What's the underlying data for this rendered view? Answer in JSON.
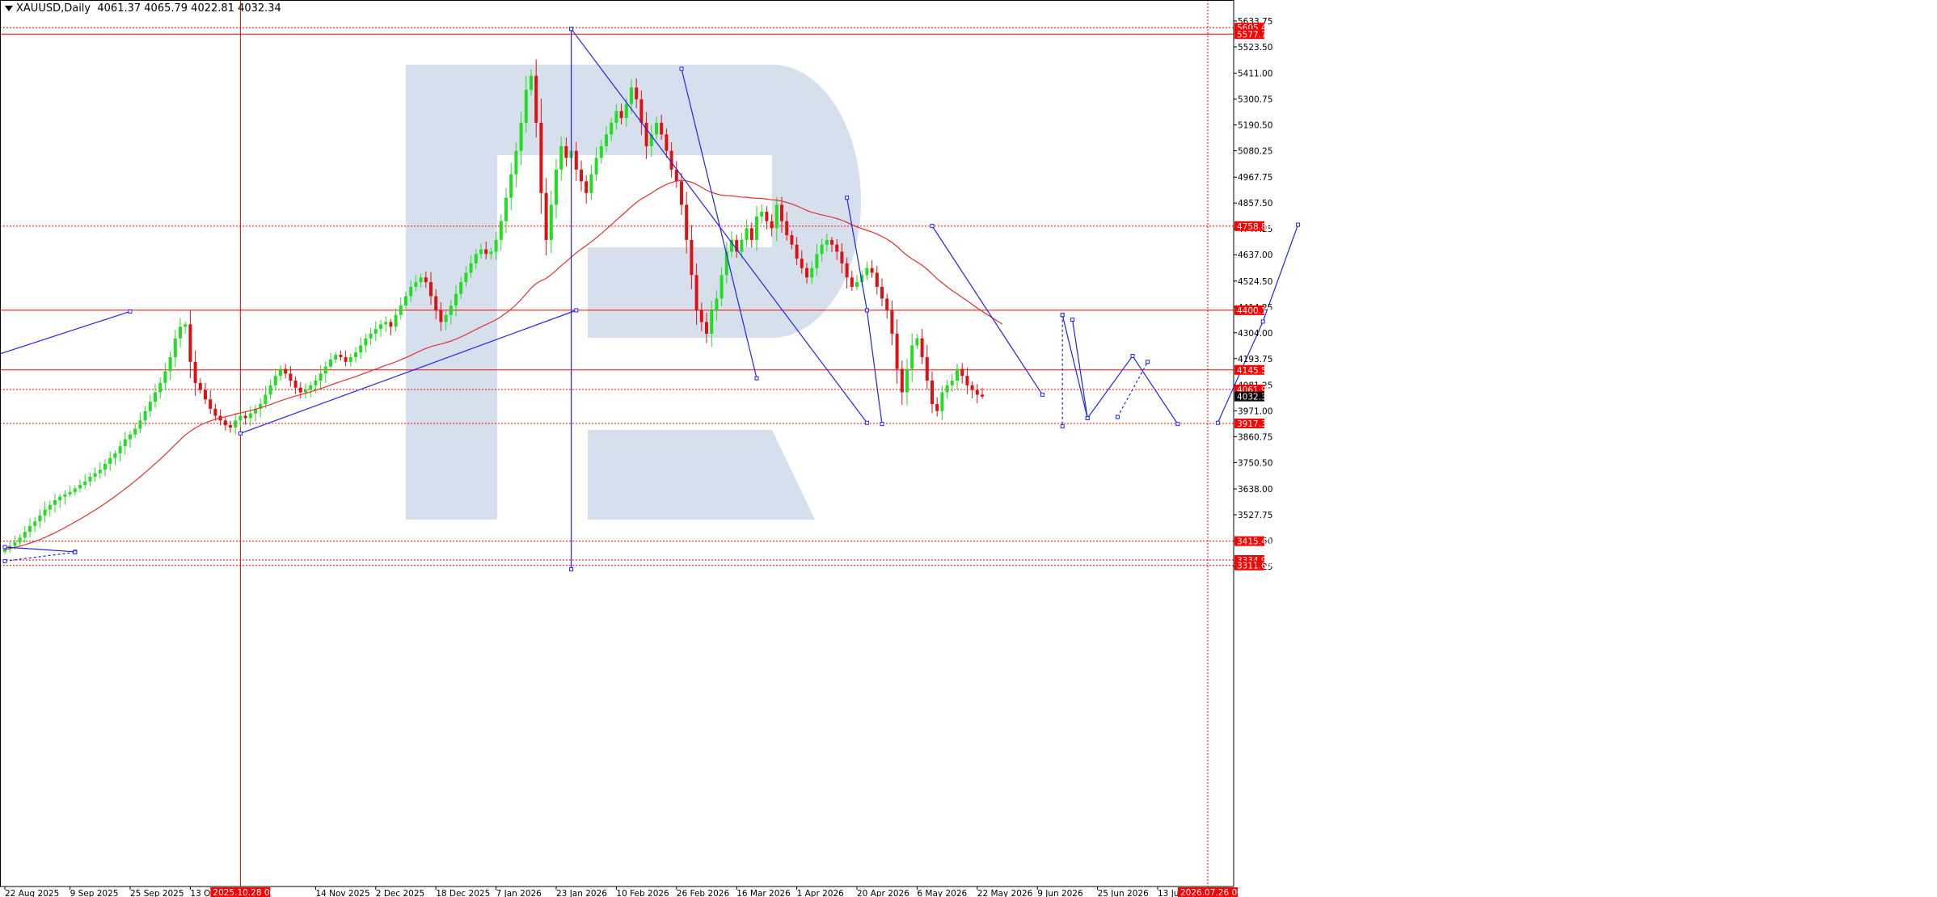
{
  "header": {
    "symbol": "XAUUSD,Daily",
    "ohlc": "4061.37 4065.79 4022.81 4032.34"
  },
  "colors": {
    "up": "#22dd22",
    "down": "#dd1111",
    "ma": "#e03030",
    "level": "#ff0000",
    "trend": "#2222ee",
    "axis": "#000000",
    "badge": "#ff0000",
    "current_badge": "#000000",
    "watermark": "#d6e0ec"
  },
  "chart_data": {
    "type": "candlestick",
    "ylim": [
      3300,
      5700
    ],
    "price_ticks": [
      "5633.75",
      "5523.50",
      "5411.00",
      "5300.75",
      "5190.50",
      "5080.25",
      "4967.75",
      "4857.50",
      "4747.25",
      "4637.00",
      "4524.50",
      "4414.25",
      "4304.00",
      "4193.75",
      "4081.25",
      "3971.00",
      "3860.75",
      "3750.50",
      "3638.00",
      "3527.75",
      "3417.50",
      "3307.25"
    ],
    "price_tick_values": [
      5633.75,
      5523.5,
      5411,
      5300.75,
      5190.5,
      5080.25,
      4967.75,
      4857.5,
      4747.25,
      4637,
      4524.5,
      4414.25,
      4304,
      4193.75,
      4081.25,
      3971,
      3860.75,
      3750.5,
      3638,
      3527.75,
      3417.5,
      3307.25
    ],
    "date_ticks": [
      "22 Aug 2025",
      "9 Sep 2025",
      "25 Sep 2025",
      "13 Oct",
      "14 Nov 2025",
      "2 Dec 2025",
      "18 Dec 2025",
      "7 Jan 2026",
      "23 Jan 2026",
      "10 Feb 2026",
      "26 Feb 2026",
      "16 Mar 2026",
      "1 Apr 2026",
      "20 Apr 2026",
      "6 May 2026",
      "22 May 2026",
      "9 Jun 2026",
      "25 Jun 2026",
      "13 Jul 20"
    ],
    "date_tick_bars": [
      0,
      13,
      25,
      37,
      62,
      74,
      86,
      98,
      110,
      122,
      134,
      146,
      158,
      170,
      182,
      194,
      206,
      218,
      230
    ],
    "date_badges": [
      {
        "label": "2025.10.28 00:00",
        "bar": 47
      },
      {
        "label": "2026.07.26 00:00",
        "bar": 240
      }
    ],
    "price_badges": [
      {
        "label": "5605.49",
        "value": 5605.49
      },
      {
        "label": "5577.71",
        "value": 5577.71
      },
      {
        "label": "4758.89",
        "value": 4758.89
      },
      {
        "label": "4400.18",
        "value": 4400.18
      },
      {
        "label": "4145.58",
        "value": 4145.58
      },
      {
        "label": "4061.99",
        "value": 4061.99
      },
      {
        "label": "4032.34",
        "value": 4032.34,
        "current": true
      },
      {
        "label": "3917.34",
        "value": 3917.34
      },
      {
        "label": "3415.40",
        "value": 3415.4
      },
      {
        "label": "3334.96",
        "value": 3334.96
      },
      {
        "label": "3311.64",
        "value": 3311.64
      }
    ],
    "levels": [
      {
        "value": 5605.49,
        "style": "dotted"
      },
      {
        "value": 5577.71,
        "style": "solid"
      },
      {
        "value": 4758.89,
        "style": "dotted"
      },
      {
        "value": 4400.18,
        "style": "solid"
      },
      {
        "value": 4145.58,
        "style": "solid"
      },
      {
        "value": 4061.99,
        "style": "dotted"
      },
      {
        "value": 3917.34,
        "style": "dotted"
      },
      {
        "value": 3415.4,
        "style": "dotted"
      },
      {
        "value": 3334.96,
        "style": "dotted"
      },
      {
        "value": 3311.64,
        "style": "dotted"
      }
    ],
    "vlines": [
      {
        "bar": 47,
        "style": "solid"
      },
      {
        "bar": 240,
        "style": "dotted"
      }
    ],
    "closes": [
      3380,
      3395,
      3410,
      3430,
      3455,
      3480,
      3500,
      3525,
      3550,
      3570,
      3590,
      3605,
      3615,
      3625,
      3640,
      3655,
      3670,
      3690,
      3705,
      3720,
      3745,
      3770,
      3790,
      3820,
      3850,
      3870,
      3895,
      3930,
      3970,
      4010,
      4050,
      4090,
      4140,
      4200,
      4280,
      4330,
      4340,
      4180,
      4090,
      4060,
      4020,
      3980,
      3950,
      3930,
      3910,
      3900,
      3930,
      3950,
      3940,
      3960,
      3980,
      4000,
      4040,
      4080,
      4120,
      4150,
      4130,
      4100,
      4070,
      4050,
      4060,
      4080,
      4100,
      4130,
      4160,
      4190,
      4210,
      4200,
      4180,
      4200,
      4220,
      4250,
      4280,
      4300,
      4320,
      4340,
      4350,
      4330,
      4380,
      4420,
      4460,
      4500,
      4520,
      4540,
      4520,
      4460,
      4400,
      4350,
      4380,
      4420,
      4470,
      4520,
      4560,
      4600,
      4640,
      4660,
      4640,
      4650,
      4700,
      4780,
      4880,
      4980,
      5080,
      5200,
      5340,
      5400,
      5200,
      4900,
      4700,
      4850,
      5000,
      5100,
      5050,
      5080,
      5000,
      4950,
      4900,
      4980,
      5050,
      5100,
      5150,
      5200,
      5250,
      5220,
      5280,
      5350,
      5300,
      5200,
      5100,
      5150,
      5200,
      5150,
      5080,
      5000,
      4950,
      4850,
      4700,
      4550,
      4400,
      4350,
      4300,
      4400,
      4450,
      4550,
      4650,
      4700,
      4650,
      4700,
      4750,
      4700,
      4800,
      4820,
      4780,
      4750,
      4850,
      4780,
      4720,
      4680,
      4620,
      4580,
      4540,
      4580,
      4640,
      4680,
      4700,
      4680,
      4650,
      4600,
      4540,
      4500,
      4520,
      4550,
      4580,
      4560,
      4500,
      4450,
      4400,
      4300,
      4150,
      4050,
      4150,
      4250,
      4280,
      4200,
      4100,
      4000,
      3970,
      4050,
      4080,
      4100,
      4150,
      4120,
      4080,
      4060,
      4040,
      4032
    ],
    "ma_values": [
      3380,
      3384,
      3389,
      3394,
      3400,
      3407,
      3414,
      3422,
      3431,
      3441,
      3451,
      3462,
      3473,
      3485,
      3497,
      3509,
      3522,
      3535,
      3548,
      3562,
      3576,
      3591,
      3606,
      3622,
      3638,
      3655,
      3672,
      3690,
      3708,
      3727,
      3746,
      3765,
      3785,
      3806,
      3827,
      3848,
      3868,
      3884,
      3898,
      3910,
      3920,
      3928,
      3935,
      3941,
      3946,
      3951,
      3957,
      3962,
      3967,
      3972,
      3978,
      3984,
      3991,
      3998,
      4006,
      4014,
      4021,
      4028,
      4034,
      4040,
      4046,
      4052,
      4059,
      4066,
      4073,
      4081,
      4089,
      4096,
      4103,
      4110,
      4117,
      4125,
      4133,
      4141,
      4149,
      4157,
      4165,
      4172,
      4180,
      4189,
      4198,
      4208,
      4218,
      4228,
      4237,
      4245,
      4251,
      4256,
      4262,
      4269,
      4277,
      4286,
      4296,
      4307,
      4318,
      4329,
      4339,
      4349,
      4360,
      4373,
      4388,
      4405,
      4424,
      4446,
      4470,
      4495,
      4514,
      4526,
      4536,
      4552,
      4570,
      4590,
      4608,
      4627,
      4645,
      4661,
      4676,
      4692,
      4709,
      4727,
      4746,
      4765,
      4785,
      4803,
      4822,
      4842,
      4860,
      4875,
      4887,
      4900,
      4914,
      4926,
      4937,
      4945,
      4951,
      4954,
      4952,
      4946,
      4936,
      4925,
      4912,
      4903,
      4896,
      4891,
      4889,
      4888,
      4885,
      4883,
      4882,
      4879,
      4878,
      4877,
      4874,
      4871,
      4870,
      4866,
      4860,
      4853,
      4845,
      4836,
      4826,
      4818,
      4812,
      4807,
      4802,
      4797,
      4791,
      4784,
      4775,
      4765,
      4756,
      4748,
      4741,
      4734,
      4725,
      4715,
      4703,
      4689,
      4672,
      4652,
      4634,
      4619,
      4606,
      4592,
      4575,
      4555,
      4534,
      4517,
      4500,
      4484,
      4470,
      4455,
      4440,
      4425,
      4410,
      4396,
      4382,
      4368,
      4354,
      4341
    ],
    "trendlines": [
      {
        "points": [
          [
            -3,
            4200
          ],
          [
            25,
            4395
          ]
        ],
        "dash": false
      },
      {
        "points": [
          [
            0,
            3390
          ],
          [
            14,
            3370
          ]
        ],
        "dash": false
      },
      {
        "points": [
          [
            0,
            3330
          ],
          [
            14,
            3368
          ]
        ],
        "dash": true
      },
      {
        "points": [
          [
            47,
            3875
          ],
          [
            114,
            4400
          ]
        ],
        "dash": false
      },
      {
        "points": [
          [
            113,
            5600
          ],
          [
            113,
            3295
          ]
        ],
        "dash": false
      },
      {
        "points": [
          [
            113,
            5600
          ],
          [
            172,
            3920
          ]
        ],
        "dash": false
      },
      {
        "points": [
          [
            135,
            5430
          ],
          [
            150,
            4110
          ]
        ],
        "dash": false
      },
      {
        "points": [
          [
            168,
            4880
          ],
          [
            172,
            4400
          ],
          [
            175,
            3915
          ]
        ],
        "dash": false
      },
      {
        "points": [
          [
            185,
            4760
          ],
          [
            207,
            4040
          ]
        ],
        "dash": false
      },
      {
        "points": [
          [
            211,
            4380
          ],
          [
            216,
            3940
          ]
        ],
        "dash": false
      },
      {
        "points": [
          [
            211,
            4380
          ],
          [
            211,
            3905
          ]
        ],
        "dash": true
      },
      {
        "points": [
          [
            213,
            4360
          ],
          [
            216,
            3940
          ],
          [
            225,
            4205
          ],
          [
            234,
            3915
          ]
        ],
        "dash": false
      },
      {
        "points": [
          [
            222,
            3945
          ],
          [
            228,
            4180
          ]
        ],
        "dash": true
      },
      {
        "points": [
          [
            242,
            3920
          ],
          [
            251,
            4352
          ],
          [
            258,
            4765
          ]
        ],
        "dash": false
      }
    ]
  }
}
